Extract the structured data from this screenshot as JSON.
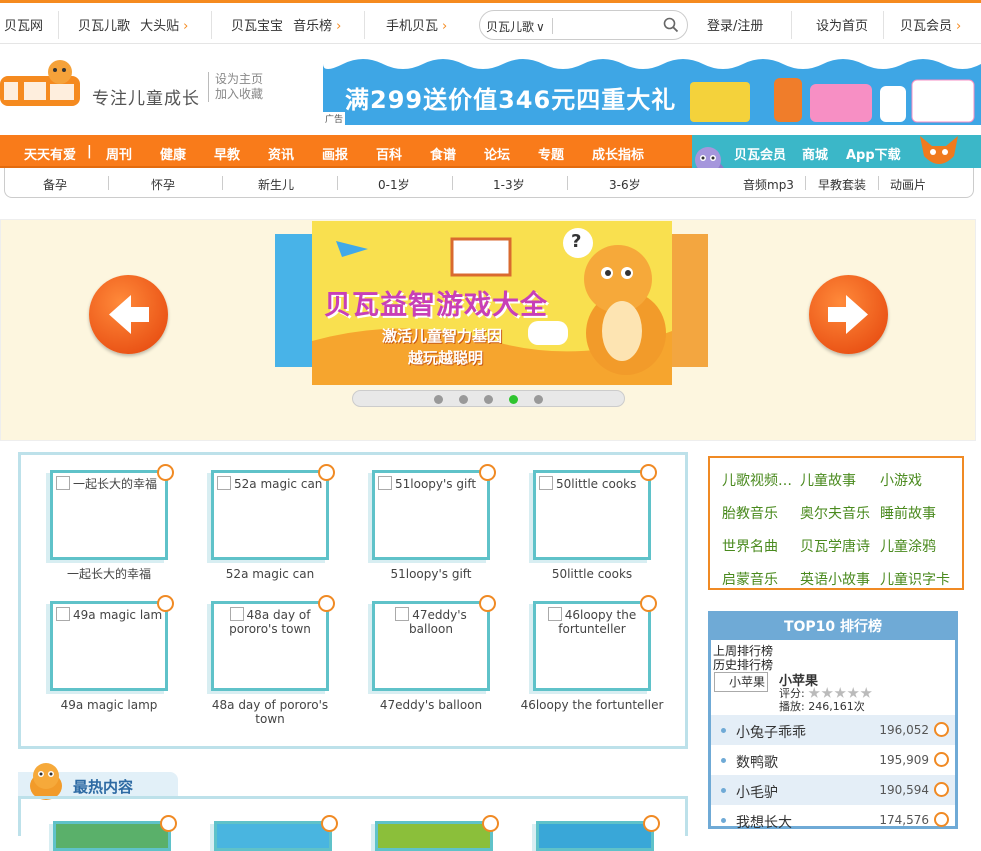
{
  "topbar": {
    "home": "贝瓦网",
    "rhyme": "贝瓦儿歌",
    "headline": "大头贴",
    "baby": "贝瓦宝宝",
    "chart": "音乐榜",
    "mobile": "手机贝瓦",
    "search_category": "贝瓦儿歌",
    "search_placeholder": "",
    "login": "登录/注册",
    "set_home": "设为首页",
    "vip": "贝瓦会员"
  },
  "header": {
    "slogan": "专注儿童成长",
    "set_home": "设为主页",
    "bookmark": "加入收藏",
    "banner_text": "满299送价值346元四重大礼",
    "banner_ad": "广告"
  },
  "nav": {
    "items": [
      "天天有爱",
      "|",
      "周刊",
      "健康",
      "早教",
      "资讯",
      "画报",
      "百科",
      "食谱",
      "论坛",
      "专题",
      "成长指标"
    ],
    "right": [
      "贝瓦会员",
      "商城",
      "App下载"
    ]
  },
  "subnav": {
    "items": [
      "备孕",
      "怀孕",
      "新生儿",
      "0-1岁",
      "1-3岁",
      "3-6岁"
    ],
    "right": [
      "音频mp3",
      "早教套装",
      "动画片"
    ]
  },
  "carousel": {
    "slide_title": "贝瓦益智游戏大全",
    "slide_line1": "激活儿童智力基因",
    "slide_line2": "越玩越聪明",
    "active_dot": 3,
    "dot_count": 5
  },
  "videos": [
    {
      "alt": "一起长大的幸福",
      "caption": "一起长大的幸福"
    },
    {
      "alt": "52a magic can",
      "caption": "52a magic can"
    },
    {
      "alt": "51loopy's gift",
      "caption": "51loopy's gift"
    },
    {
      "alt": "50little cooks",
      "caption": "50little cooks"
    },
    {
      "alt": "49a magic lamp",
      "caption": "49a magic lamp"
    },
    {
      "alt": "48a day of pororo's town",
      "caption": "48a day of pororo's town"
    },
    {
      "alt": "47eddy's balloon",
      "caption": "47eddy's balloon"
    },
    {
      "alt": "46loopy the fortunteller",
      "caption": "46loopy the fortunteller"
    }
  ],
  "keywords": [
    "儿歌视频…",
    "儿童故事",
    "小游戏",
    "胎教音乐",
    "奥尔夫音乐",
    "睡前故事",
    "世界名曲",
    "贝瓦学唐诗",
    "儿童涂鸦",
    "启蒙音乐",
    "英语小故事",
    "儿童识字卡"
  ],
  "top10": {
    "title": "TOP10 排行榜",
    "last_week": "上周排行榜",
    "history": "历史排行榜",
    "thumb_alt": "小苹果",
    "name": "小苹果",
    "rating_label": "评分:",
    "plays": "播放: 246,161次",
    "stars": 0,
    "rows": [
      {
        "title": "小兔子乖乖",
        "count": "196,052"
      },
      {
        "title": "数鸭歌",
        "count": "195,909"
      },
      {
        "title": "小毛驴",
        "count": "190,594"
      },
      {
        "title": "我想长大",
        "count": "174,576"
      }
    ]
  },
  "hot": {
    "label": "最热内容"
  },
  "colors": {
    "orange": "#f97b1a",
    "teal": "#3bb7c8",
    "blue": "#6faad6",
    "green": "#4a8a1e"
  }
}
